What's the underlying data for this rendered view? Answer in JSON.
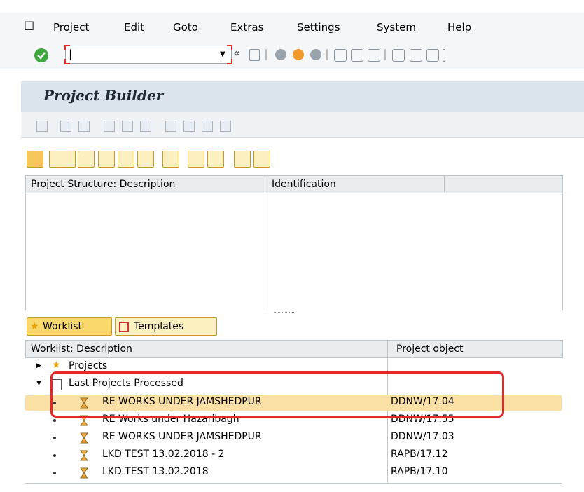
{
  "menubar": {
    "items": [
      "Project",
      "Edit",
      "Goto",
      "Extras",
      "Settings",
      "System",
      "Help"
    ]
  },
  "toolbar": {
    "command_value": "|",
    "back_glyph": "«"
  },
  "page": {
    "title": "Project Builder"
  },
  "structure": {
    "col1": "Project Structure: Description",
    "col2": "Identification"
  },
  "worklist": {
    "tabs": [
      "Worklist",
      "Templates"
    ],
    "col1": "Worklist: Description",
    "col2": "Project object",
    "folders": [
      {
        "label": "Projects"
      },
      {
        "label": "Last Projects Processed"
      }
    ],
    "rows": [
      {
        "desc": "RE WORKS UNDER JAMSHEDPUR",
        "obj": "DDNW/17.04",
        "selected": true
      },
      {
        "desc": "RE Works under Hazaribagh",
        "obj": "DDNW/17.55",
        "selected": false
      },
      {
        "desc": "RE WORKS UNDER JAMSHEDPUR",
        "obj": "DDNW/17.03",
        "selected": false
      },
      {
        "desc": "LKD TEST 13.02.2018 - 2",
        "obj": "RAPB/17.12",
        "selected": false
      },
      {
        "desc": "LKD TEST 13.02.2018",
        "obj": "RAPB/17.10",
        "selected": false
      }
    ]
  },
  "colors": {
    "highlight_row": "#fbe0a6",
    "callout_red": "#e32a2a",
    "title_bar": "#dbe4ec"
  }
}
